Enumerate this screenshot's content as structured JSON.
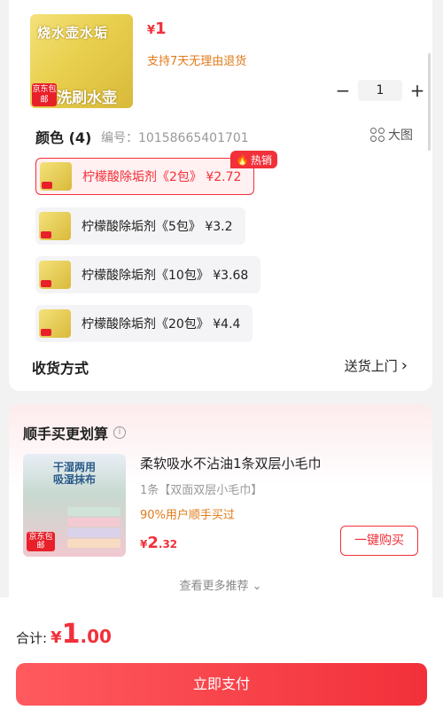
{
  "product": {
    "thumb_text_top": "烧水壶水垢",
    "thumb_text_bottom": "洗刷水壶",
    "thumb_badge": "京东包邮",
    "price_symbol": "¥",
    "price": "1",
    "return_note": "支持7天无理由退货",
    "quantity": "1",
    "minus": "−",
    "plus": "+"
  },
  "color_section": {
    "title": "颜色 (4)",
    "sku_label": "编号：10158665401701",
    "big_pic_label": "大图",
    "hot_badge": "热销",
    "options": [
      {
        "label": "柠檬酸除垢剂《2包》 ¥2.72",
        "selected": true
      },
      {
        "label": "柠檬酸除垢剂《5包》 ¥3.2",
        "selected": false
      },
      {
        "label": "柠檬酸除垢剂《10包》 ¥3.68",
        "selected": false
      },
      {
        "label": "柠檬酸除垢剂《20包》 ¥4.4",
        "selected": false
      }
    ]
  },
  "delivery": {
    "title": "收货方式",
    "value": "送货上门"
  },
  "recommend": {
    "title": "顺手买更划算",
    "image_tag": "干湿两用\n吸湿抹布",
    "image_badge": "京东包邮",
    "name": "柔软吸水不沾油1条双层小毛巾",
    "spec": "1条【双面双层小毛巾】",
    "percent_note": "90%用户顺手买过",
    "price_symbol": "¥",
    "price_int": "2",
    "price_dec": ".32",
    "buy_label": "一键购买",
    "more_label": "查看更多推荐"
  },
  "footer": {
    "total_label": "合计:",
    "total_symbol": "¥",
    "total_int": "1",
    "total_dec": ".00",
    "pay_label": "立即支付"
  },
  "colors": {
    "accent": "#f2303a",
    "orange": "#e07a1a"
  }
}
